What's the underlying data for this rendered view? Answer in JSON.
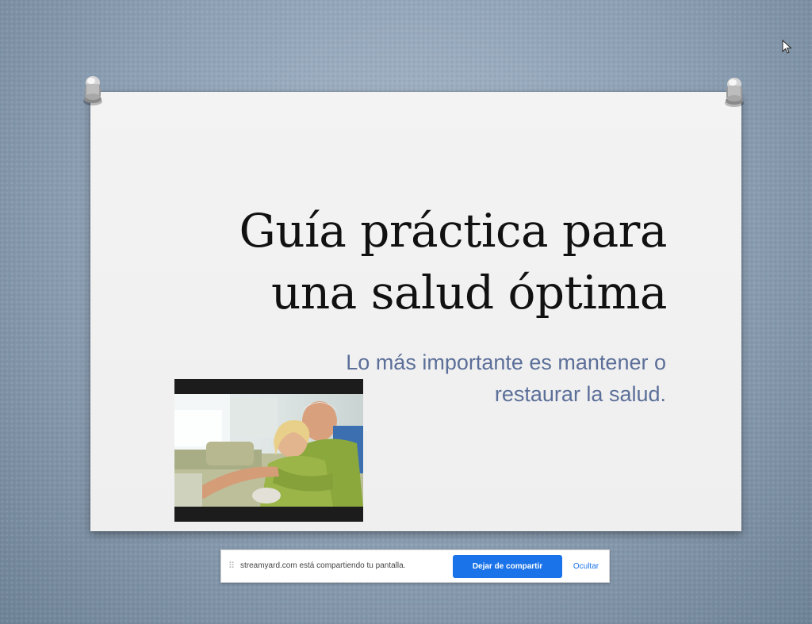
{
  "slide": {
    "title_line1": "Guía práctica para",
    "title_line2": "una salud óptima",
    "subtitle_line1": "Lo más importante es mantener o",
    "subtitle_line2": "restaurar la salud.",
    "image_icon": "photo-elderly-couple-laughing",
    "pin_icon": "pushpin-icon"
  },
  "share_bar": {
    "handle_icon": "drag-handle-icon",
    "message": "streamyard.com está compartiendo tu pantalla.",
    "stop_label": "Dejar de compartir",
    "hide_label": "Ocultar"
  },
  "colors": {
    "background": "#8a9db1",
    "slide_paper": "#f0f0f0",
    "title_text": "#111111",
    "subtitle_text": "#5c6f99",
    "button_blue": "#1a73e8"
  }
}
